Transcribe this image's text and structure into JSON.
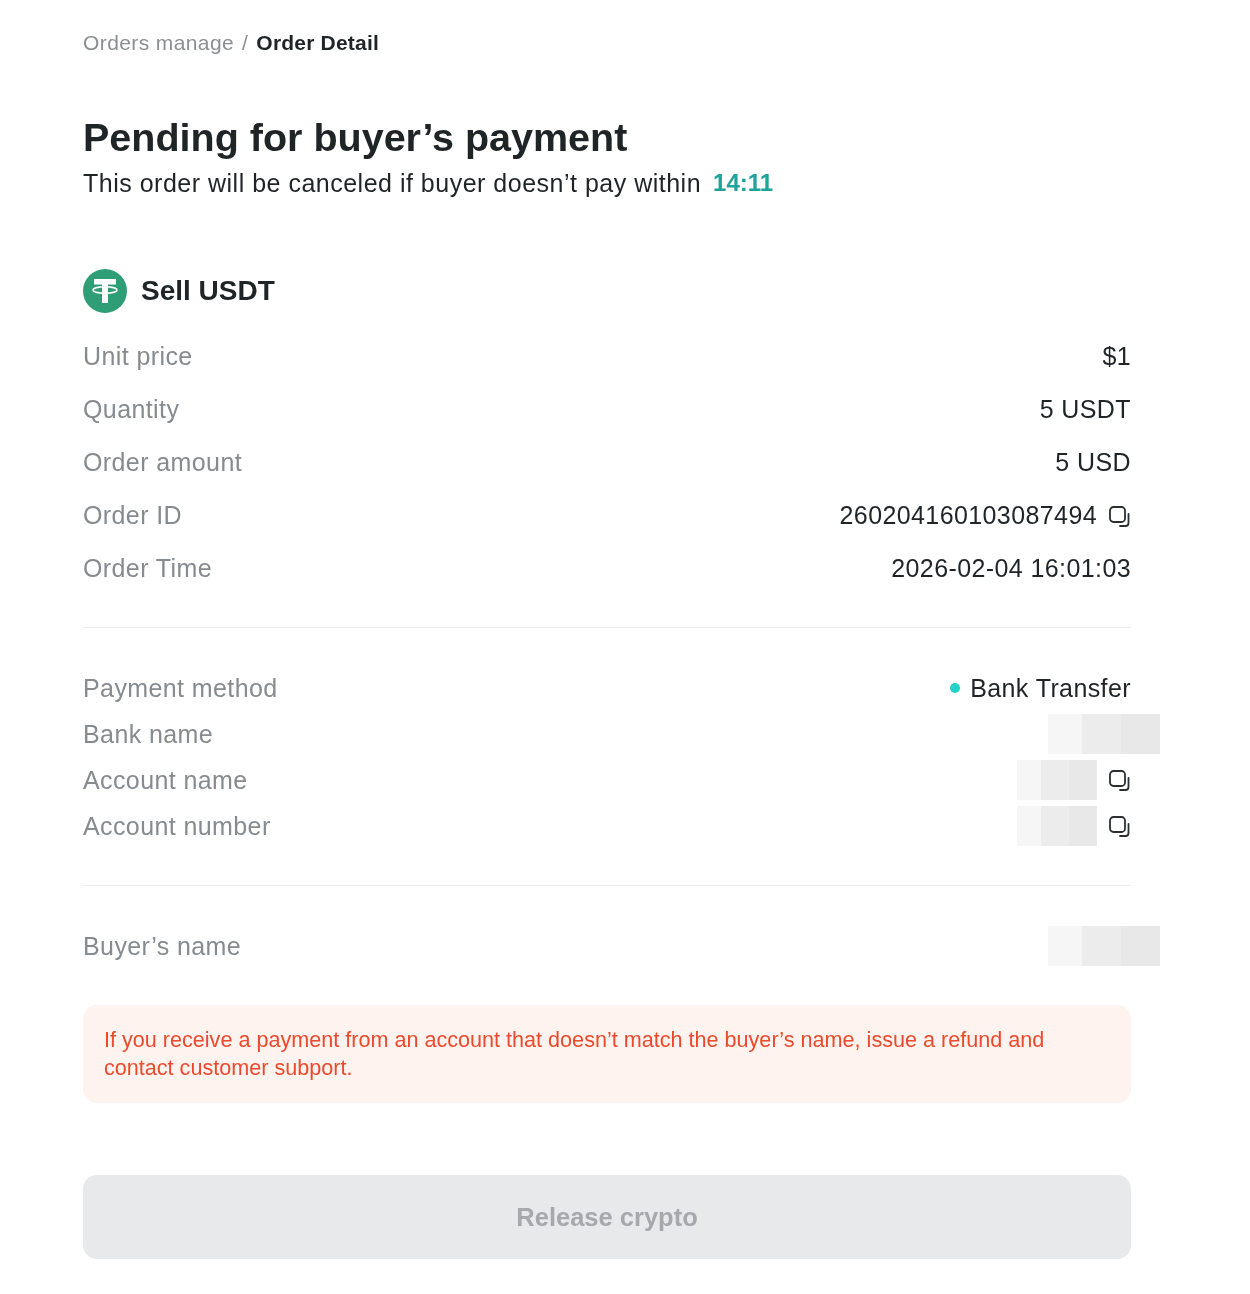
{
  "breadcrumb": {
    "separator": "/",
    "items": [
      {
        "label": "Orders manage",
        "current": false
      },
      {
        "label": "Order Detail",
        "current": true
      }
    ]
  },
  "status": {
    "title": "Pending for buyer’s payment",
    "message": "This order will be canceled if buyer doesn’t pay within",
    "countdown": "14:11"
  },
  "order": {
    "title": "Sell USDT",
    "rows": [
      {
        "label": "Unit price",
        "kind": "text",
        "value": "$1",
        "copyable": false
      },
      {
        "label": "Quantity",
        "kind": "text",
        "value": "5 USDT",
        "copyable": false
      },
      {
        "label": "Order amount",
        "kind": "text",
        "value": "5 USD",
        "copyable": false
      },
      {
        "label": "Order ID",
        "kind": "text",
        "value": "260204160103087494",
        "copyable": true
      },
      {
        "label": "Order Time",
        "kind": "text",
        "value": "2026-02-04 16:01:03",
        "copyable": false
      }
    ]
  },
  "payment": {
    "rows": [
      {
        "label": "Payment method",
        "kind": "method",
        "value": "Bank Transfer",
        "copyable": false
      },
      {
        "label": "Bank name",
        "kind": "redacted",
        "copyable": false
      },
      {
        "label": "Account name",
        "kind": "redacted",
        "copyable": true
      },
      {
        "label": "Account number",
        "kind": "redacted",
        "copyable": true
      }
    ]
  },
  "buyer": {
    "rows": [
      {
        "label": "Buyer’s name",
        "kind": "redacted",
        "copyable": false
      }
    ]
  },
  "warning": "If you receive a payment from an account that doesn’t match the buyer’s name, issue a refund and contact customer subport.",
  "button": {
    "label": "Release crypto",
    "disabled": true
  }
}
